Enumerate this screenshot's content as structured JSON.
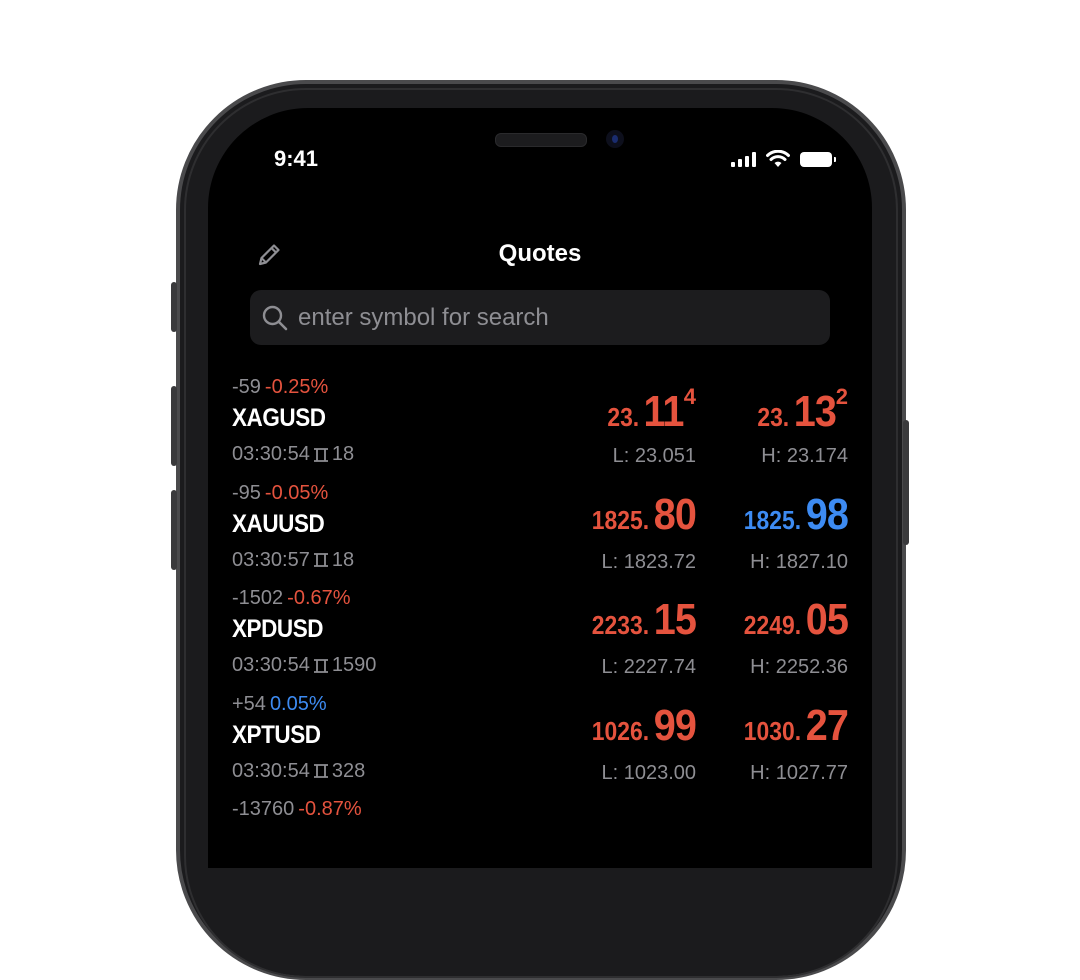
{
  "status": {
    "time": "9:41"
  },
  "header": {
    "title": "Quotes"
  },
  "search": {
    "placeholder": "enter symbol for search"
  },
  "colors": {
    "down": "#e5533e",
    "up": "#3d8bf2"
  },
  "quotes": [
    {
      "change_points": "-59",
      "change_pct": "-0.25%",
      "change_dir": "down",
      "symbol": "XAGUSD",
      "time": "03:30:54",
      "spread": "18",
      "bid": {
        "small": "23.",
        "big": "11",
        "sup": "4",
        "dir": "down"
      },
      "ask": {
        "small": "23.",
        "big": "13",
        "sup": "2",
        "dir": "down"
      },
      "low": "L: 23.051",
      "high": "H: 23.174"
    },
    {
      "change_points": "-95",
      "change_pct": "-0.05%",
      "change_dir": "down",
      "symbol": "XAUUSD",
      "time": "03:30:57",
      "spread": "18",
      "bid": {
        "small": "1825.",
        "big": "80",
        "sup": "",
        "dir": "down"
      },
      "ask": {
        "small": "1825.",
        "big": "98",
        "sup": "",
        "dir": "up"
      },
      "low": "L: 1823.72",
      "high": "H: 1827.10"
    },
    {
      "change_points": "-1502",
      "change_pct": "-0.67%",
      "change_dir": "down",
      "symbol": "XPDUSD",
      "time": "03:30:54",
      "spread": "1590",
      "bid": {
        "small": "2233.",
        "big": "15",
        "sup": "",
        "dir": "down"
      },
      "ask": {
        "small": "2249.",
        "big": "05",
        "sup": "",
        "dir": "down"
      },
      "low": "L: 2227.74",
      "high": "H: 2252.36"
    },
    {
      "change_points": "+54",
      "change_pct": "0.05%",
      "change_dir": "up",
      "symbol": "XPTUSD",
      "time": "03:30:54",
      "spread": "328",
      "bid": {
        "small": "1026.",
        "big": "99",
        "sup": "",
        "dir": "down"
      },
      "ask": {
        "small": "1030.",
        "big": "27",
        "sup": "",
        "dir": "down"
      },
      "low": "L: 1023.00",
      "high": "H: 1027.77"
    },
    {
      "change_points": "-13760",
      "change_pct": "-0.87%",
      "change_dir": "down",
      "symbol": "",
      "time": "",
      "spread": "",
      "bid": {
        "small": "",
        "big": "",
        "sup": "",
        "dir": "up"
      },
      "ask": {
        "small": "",
        "big": "",
        "sup": "",
        "dir": "up"
      },
      "low": "",
      "high": ""
    }
  ]
}
